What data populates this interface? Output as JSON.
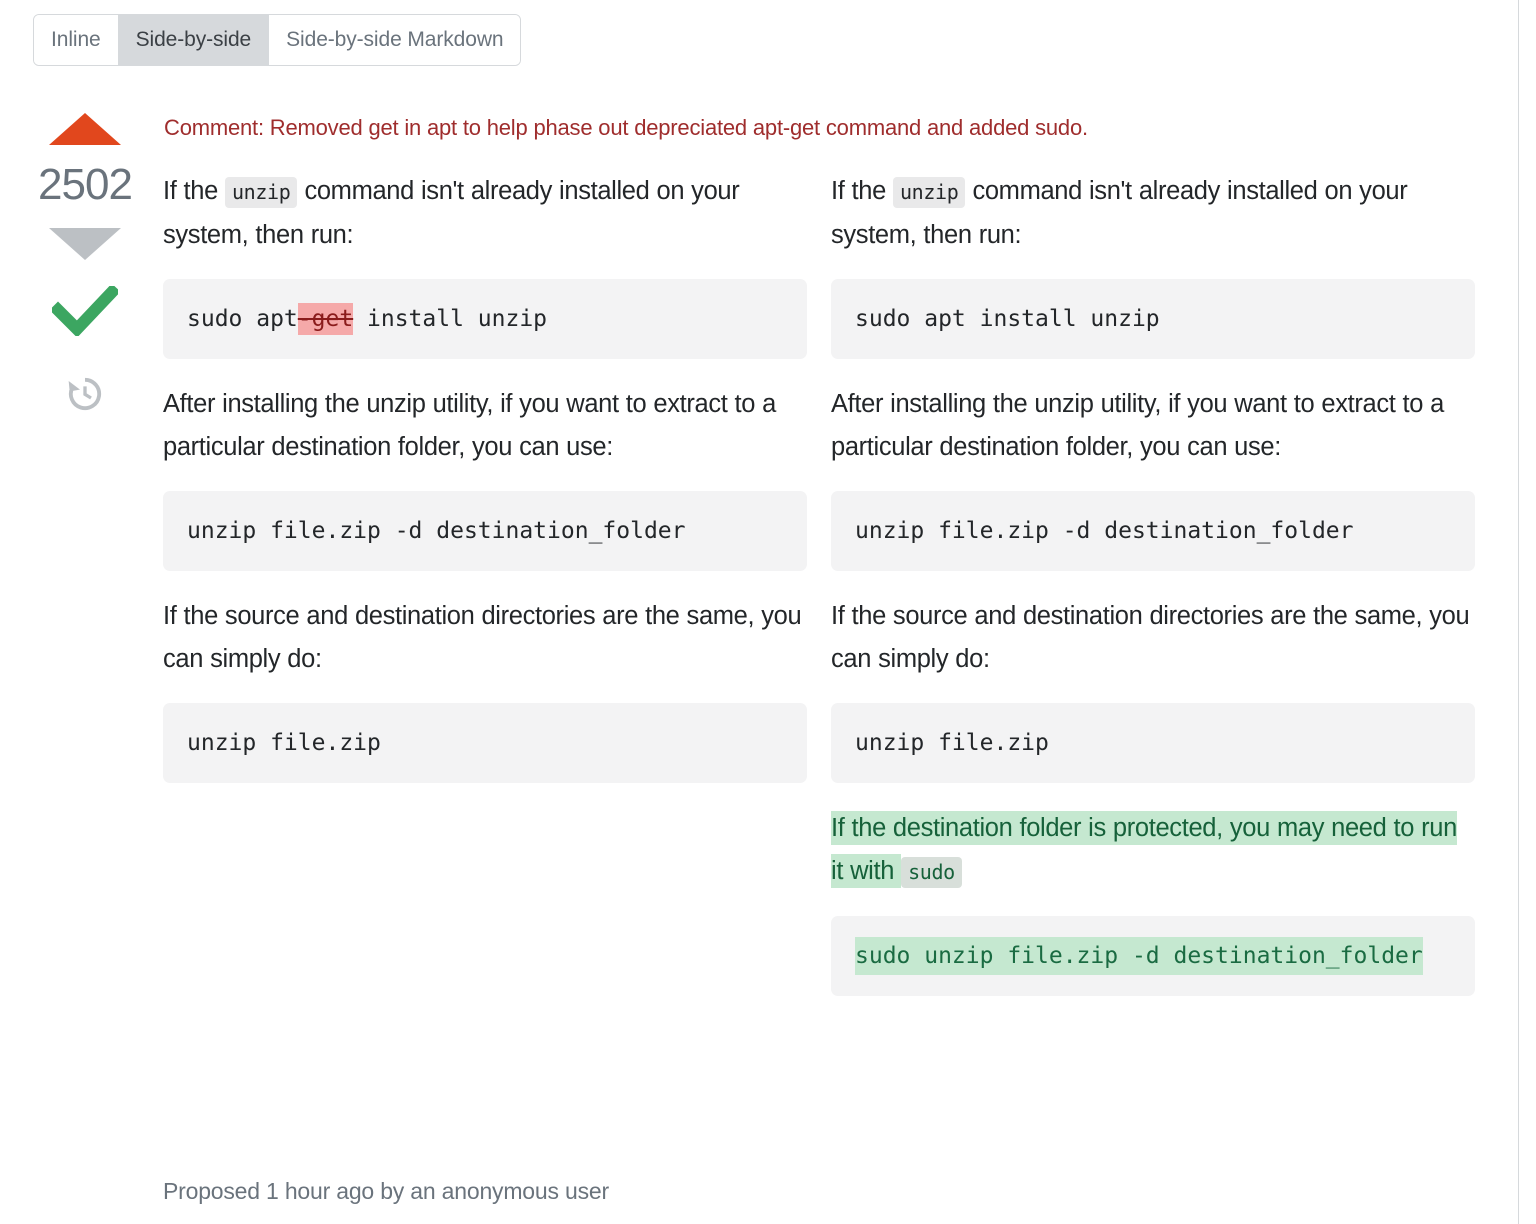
{
  "tabs": [
    {
      "label": "Inline",
      "active": false
    },
    {
      "label": "Side-by-side",
      "active": true
    },
    {
      "label": "Side-by-side Markdown",
      "active": false
    }
  ],
  "votes": {
    "count": "2502",
    "upvote_icon": "triangle-up-icon",
    "downvote_icon": "triangle-down-icon",
    "approve_icon": "checkmark-icon",
    "history_icon": "history-clock-icon"
  },
  "comment": {
    "text": "Comment: Removed get in apt to help phase out depreciated apt-get command and added sudo."
  },
  "left": {
    "p1_before": "If the ",
    "p1_code": "unzip",
    "p1_after": " command isn't already installed on your system, then run:",
    "code1_pre": "sudo apt",
    "code1_del": "-get",
    "code1_post": " install unzip",
    "p2": "After installing the unzip utility, if you want to extract to a particular destination folder, you can use:",
    "code2": "unzip file.zip -d destination_folder",
    "p3": "If the source and destination directories are the same, you can simply do:",
    "code3": "unzip file.zip"
  },
  "right": {
    "p1_before": "If the ",
    "p1_code": "unzip",
    "p1_after": " command isn't already installed on your system, then run:",
    "code1": "sudo apt install unzip",
    "p2": "After installing the unzip utility, if you want to extract to a particular destination folder, you can use:",
    "code2": "unzip file.zip -d destination_folder",
    "p3": "If the source and destination directories are the same, you can simply do:",
    "code3": "unzip file.zip",
    "p4_added_before": "If the destination folder is protected, you may need to run it with ",
    "p4_added_code": "sudo",
    "code4_added": "sudo unzip file.zip -d destination_folder"
  },
  "footer": {
    "text": "Proposed 1 hour ago by an anonymous user"
  },
  "colors": {
    "upvote": "#e1471d",
    "downvote": "#bcc0c4",
    "approve": "#3ca661",
    "comment_red": "#9f2d2d",
    "del_bg": "#f5a9a9",
    "ins_bg": "#c5e8d0",
    "code_bg": "#f3f3f4",
    "active_tab_bg": "#d6d9dc"
  }
}
